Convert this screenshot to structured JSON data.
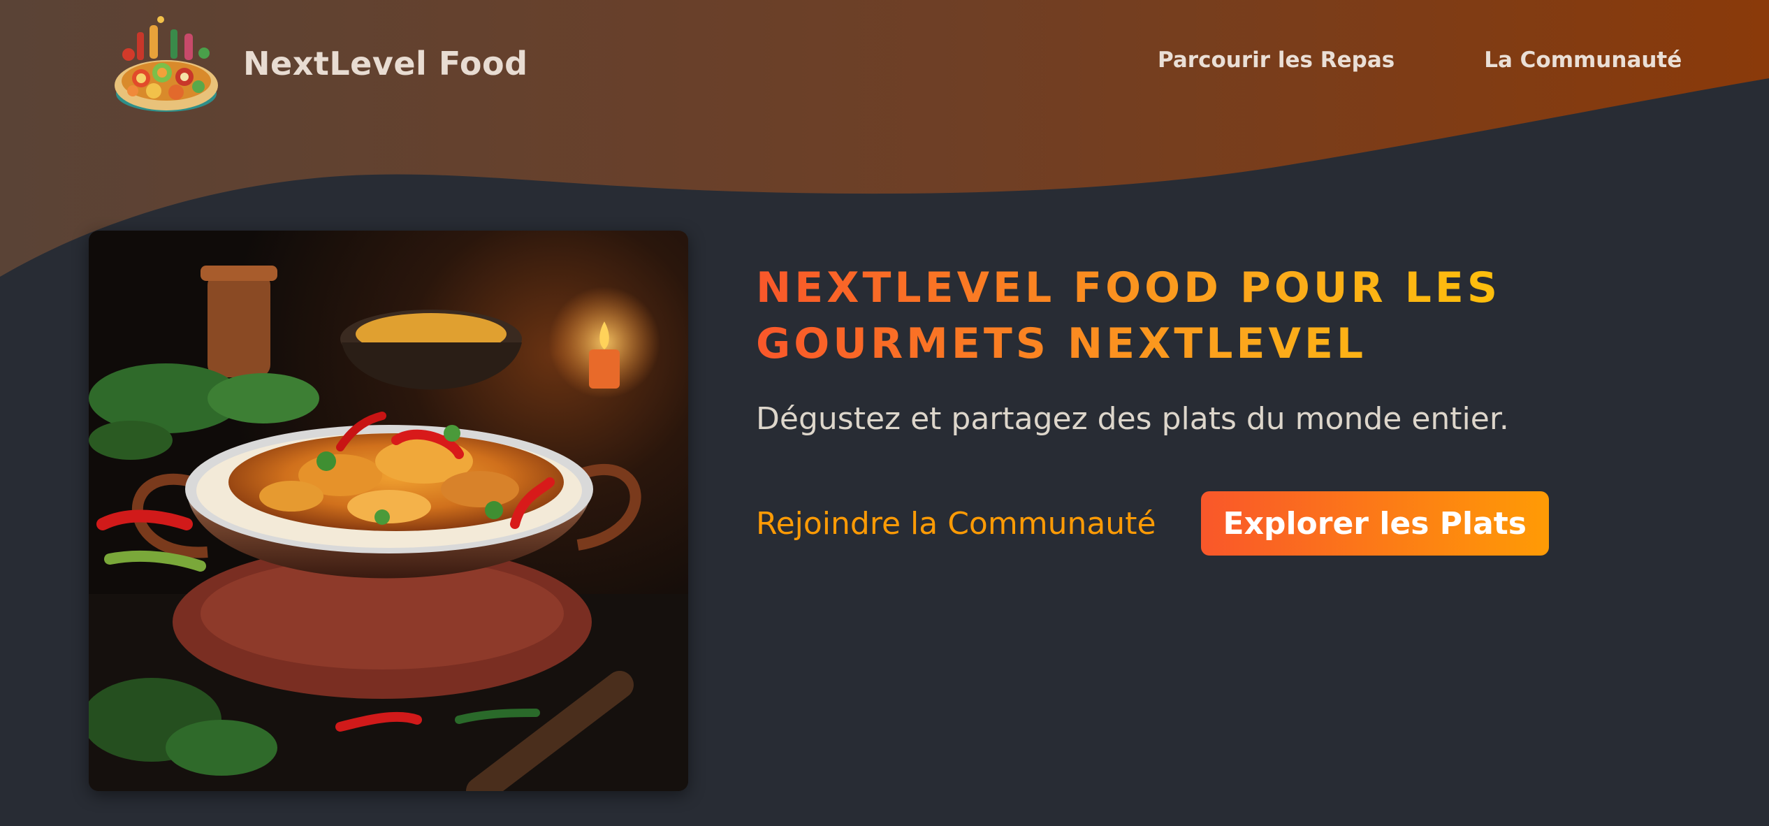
{
  "header": {
    "brand_name": "NextLevel Food",
    "nav": [
      {
        "label": "Parcourir les Repas"
      },
      {
        "label": "La Communauté"
      }
    ]
  },
  "hero": {
    "title": "NextLevel Food pour les gourmets NextLevel",
    "subtitle": "Dégustez et partagez des plats du monde entier.",
    "join_link": "Rejoindre la Communauté",
    "explore_button": "Explorer les Plats"
  },
  "icons": {
    "logo": "food-platter-icon",
    "hero_image": "curry-dish-photo"
  },
  "colors": {
    "background": "#282c34",
    "header_gradient_start": "#5a4336",
    "header_gradient_end": "#8a3a0a",
    "accent_orange": "#f9572a",
    "accent_yellow": "#ff9b05",
    "nav_text": "#eadfd6"
  }
}
